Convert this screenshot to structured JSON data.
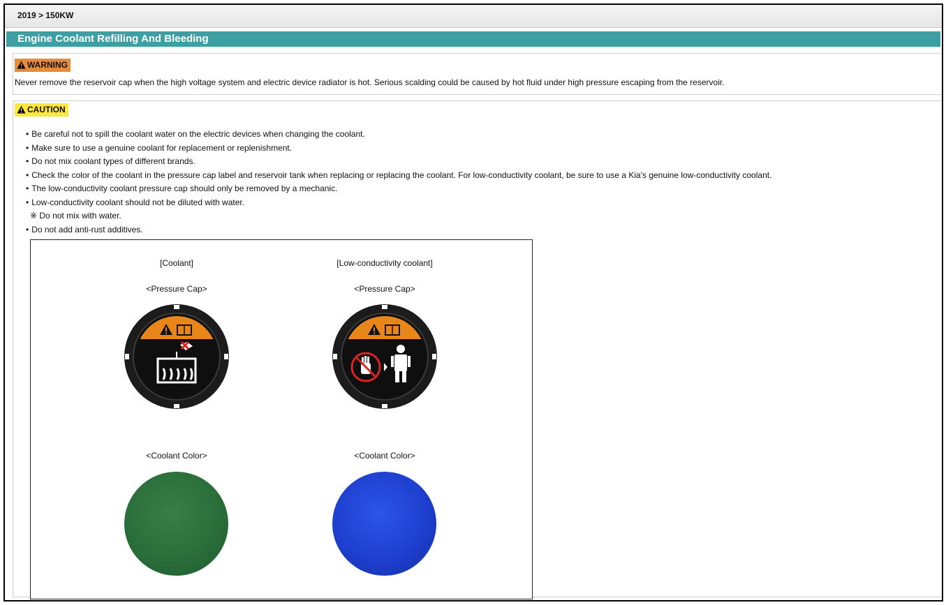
{
  "breadcrumb": "2019 > 150KW",
  "title": "Engine Coolant Refilling And Bleeding",
  "warning": {
    "label": "WARNING",
    "text": "Never remove the reservoir cap when the high voltage system and electric device radiator is hot. Serious scalding could be caused by hot fluid under high pressure escaping from the reservoir."
  },
  "caution": {
    "label": "CAUTION",
    "items": [
      "Be careful not to spill the coolant water on the electric devices when changing the coolant.",
      "Make sure to use a genuine coolant for replacement or replenishment.",
      "Do not mix coolant types of different brands.",
      "Check the color of the coolant in the pressure cap label and reservoir tank when replacing or replacing the coolant. For low-conductivity coolant, be sure to use a Kia's genuine low-conductivity coolant.",
      "The low-conductivity coolant pressure cap should only be removed by a mechanic.",
      "Low-conductivity coolant should not be diluted with water.",
      "※ Do not mix with water.",
      "Do not add anti-rust additives."
    ]
  },
  "figure": {
    "left": {
      "heading": "[Coolant]",
      "cap_label": "<Pressure Cap>",
      "color_label": "<Coolant Color>",
      "swatch_color": "#2a6e3a"
    },
    "right": {
      "heading": "[Low-conductivity coolant]",
      "cap_label": "<Pressure Cap>",
      "color_label": "<Coolant Color>",
      "swatch_color": "#1e3fd0"
    }
  },
  "colors": {
    "title_bar": "#3c9fa4",
    "warning_badge": "#e58b3c",
    "caution_badge": "#ffe83d",
    "cap_band": "#e8861a"
  },
  "icons": [
    "warning-triangle-icon",
    "manual-book-icon",
    "no-hand-icon",
    "mechanic-icon",
    "hot-radiator-icon"
  ]
}
